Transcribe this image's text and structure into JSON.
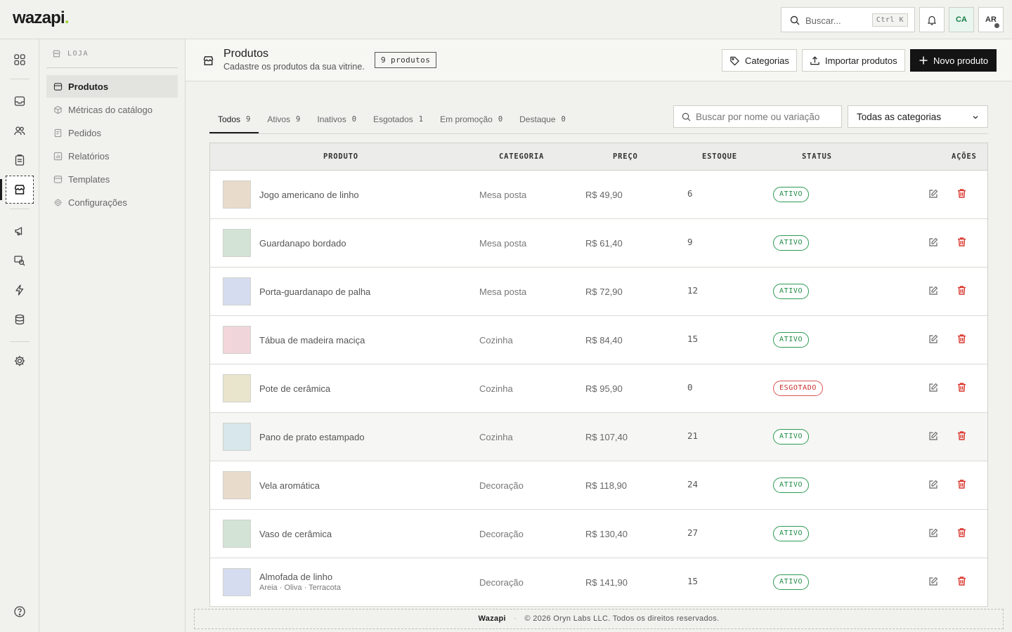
{
  "app": {
    "logo": "wazapi",
    "logo_dot": "."
  },
  "topbar": {
    "search_placeholder": "Buscar...",
    "shortcut": "Ctrl K",
    "avatar_ca": "CA",
    "avatar_ar": "AR"
  },
  "sidebar": {
    "section": "LOJA",
    "items": [
      {
        "label": "Produtos",
        "icon": "box-icon",
        "active": true
      },
      {
        "label": "Métricas do catálogo",
        "icon": "cube-icon"
      },
      {
        "label": "Pedidos",
        "icon": "receipt-icon"
      },
      {
        "label": "Relatórios",
        "icon": "chart-icon"
      },
      {
        "label": "Templates",
        "icon": "template-icon"
      },
      {
        "label": "Configurações",
        "icon": "gear-icon"
      }
    ]
  },
  "page": {
    "title": "Produtos",
    "subtitle": "Cadastre os produtos da sua vitrine.",
    "count_badge": "9 produtos",
    "btn_categories": "Categorias",
    "btn_import": "Importar produtos",
    "btn_new": "Novo produto"
  },
  "tabs": [
    {
      "label": "Todos",
      "count": "9",
      "active": true
    },
    {
      "label": "Ativos",
      "count": "9"
    },
    {
      "label": "Inativos",
      "count": "0"
    },
    {
      "label": "Esgotados",
      "count": "1"
    },
    {
      "label": "Em promoção",
      "count": "0"
    },
    {
      "label": "Destaque",
      "count": "0"
    }
  ],
  "filters": {
    "search_placeholder": "Buscar por nome ou variação",
    "category_value": "Todas as categorias"
  },
  "table": {
    "headers": {
      "product": "PRODUTO",
      "category": "CATEGORIA",
      "price": "PREÇO",
      "stock": "ESTOQUE",
      "status": "STATUS",
      "actions": "AÇÕES"
    },
    "rows": [
      {
        "name": "Jogo americano de linho",
        "variants": "",
        "category": "Mesa posta",
        "price": "R$ 49,90",
        "stock": "6",
        "status": "ATIVO",
        "thumb": "#e8dbcb"
      },
      {
        "name": "Guardanapo bordado",
        "variants": "",
        "category": "Mesa posta",
        "price": "R$ 61,40",
        "stock": "9",
        "status": "ATIVO",
        "thumb": "#d3e4d7"
      },
      {
        "name": "Porta-guardanapo de palha",
        "variants": "",
        "category": "Mesa posta",
        "price": "R$ 72,90",
        "stock": "12",
        "status": "ATIVO",
        "thumb": "#d6dcf0"
      },
      {
        "name": "Tábua de madeira maciça",
        "variants": "",
        "category": "Cozinha",
        "price": "R$ 84,40",
        "stock": "15",
        "status": "ATIVO",
        "thumb": "#f0d6da"
      },
      {
        "name": "Pote de cerâmica",
        "variants": "",
        "category": "Cozinha",
        "price": "R$ 95,90",
        "stock": "0",
        "status": "ESGOTADO",
        "thumb": "#e9e4cc"
      },
      {
        "name": "Pano de prato estampado",
        "variants": "",
        "category": "Cozinha",
        "price": "R$ 107,40",
        "stock": "21",
        "status": "ATIVO",
        "thumb": "#d8e7ec"
      },
      {
        "name": "Vela aromática",
        "variants": "",
        "category": "Decoração",
        "price": "R$ 118,90",
        "stock": "24",
        "status": "ATIVO",
        "thumb": "#e8dbcb"
      },
      {
        "name": "Vaso de cerâmica",
        "variants": "",
        "category": "Decoração",
        "price": "R$ 130,40",
        "stock": "27",
        "status": "ATIVO",
        "thumb": "#d3e4d7"
      },
      {
        "name": "Almofada de linho",
        "variants": "Areia · Oliva · Terracota",
        "category": "Decoração",
        "price": "R$ 141,90",
        "stock": "15",
        "status": "ATIVO",
        "thumb": "#d6dcf0"
      }
    ]
  },
  "footer": {
    "brand": "Wazapi",
    "sep": "·",
    "copyright": "© 2026 Oryn Labs LLC. Todos os direitos reservados."
  },
  "colors": {
    "accent_dark": "#141414",
    "status_active": "#1d8a44",
    "status_out": "#c9302c",
    "delete_red": "#d9342b",
    "logo_dot": "#9ad32e"
  }
}
